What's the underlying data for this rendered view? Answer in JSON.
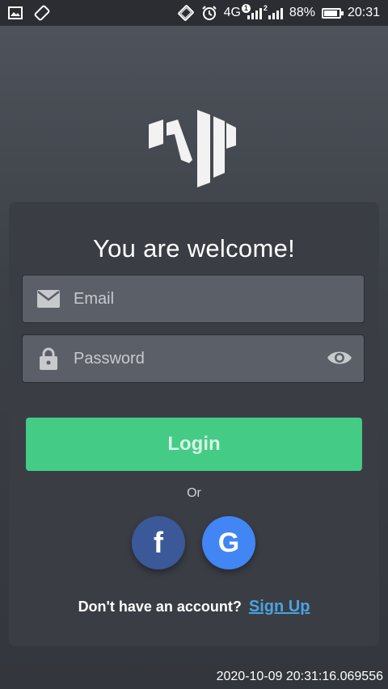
{
  "status_bar": {
    "network": "4G",
    "sim1": "1",
    "sim2": "2",
    "battery": "88%",
    "battery_level": 0.88,
    "time": "20:31"
  },
  "card": {
    "welcome": "You are welcome!",
    "email_placeholder": "Email",
    "password_placeholder": "Password",
    "login_label": "Login",
    "or_label": "Or",
    "facebook_glyph": "f",
    "google_glyph": "G",
    "no_account_text": "Don't have an account?",
    "signup_label": "Sign Up"
  },
  "timestamp": "2020-10-09 20:31:16.069556",
  "colors": {
    "accent_green": "#44cc87",
    "facebook": "#3b5998",
    "google": "#4285f4",
    "link": "#4aa3df"
  }
}
